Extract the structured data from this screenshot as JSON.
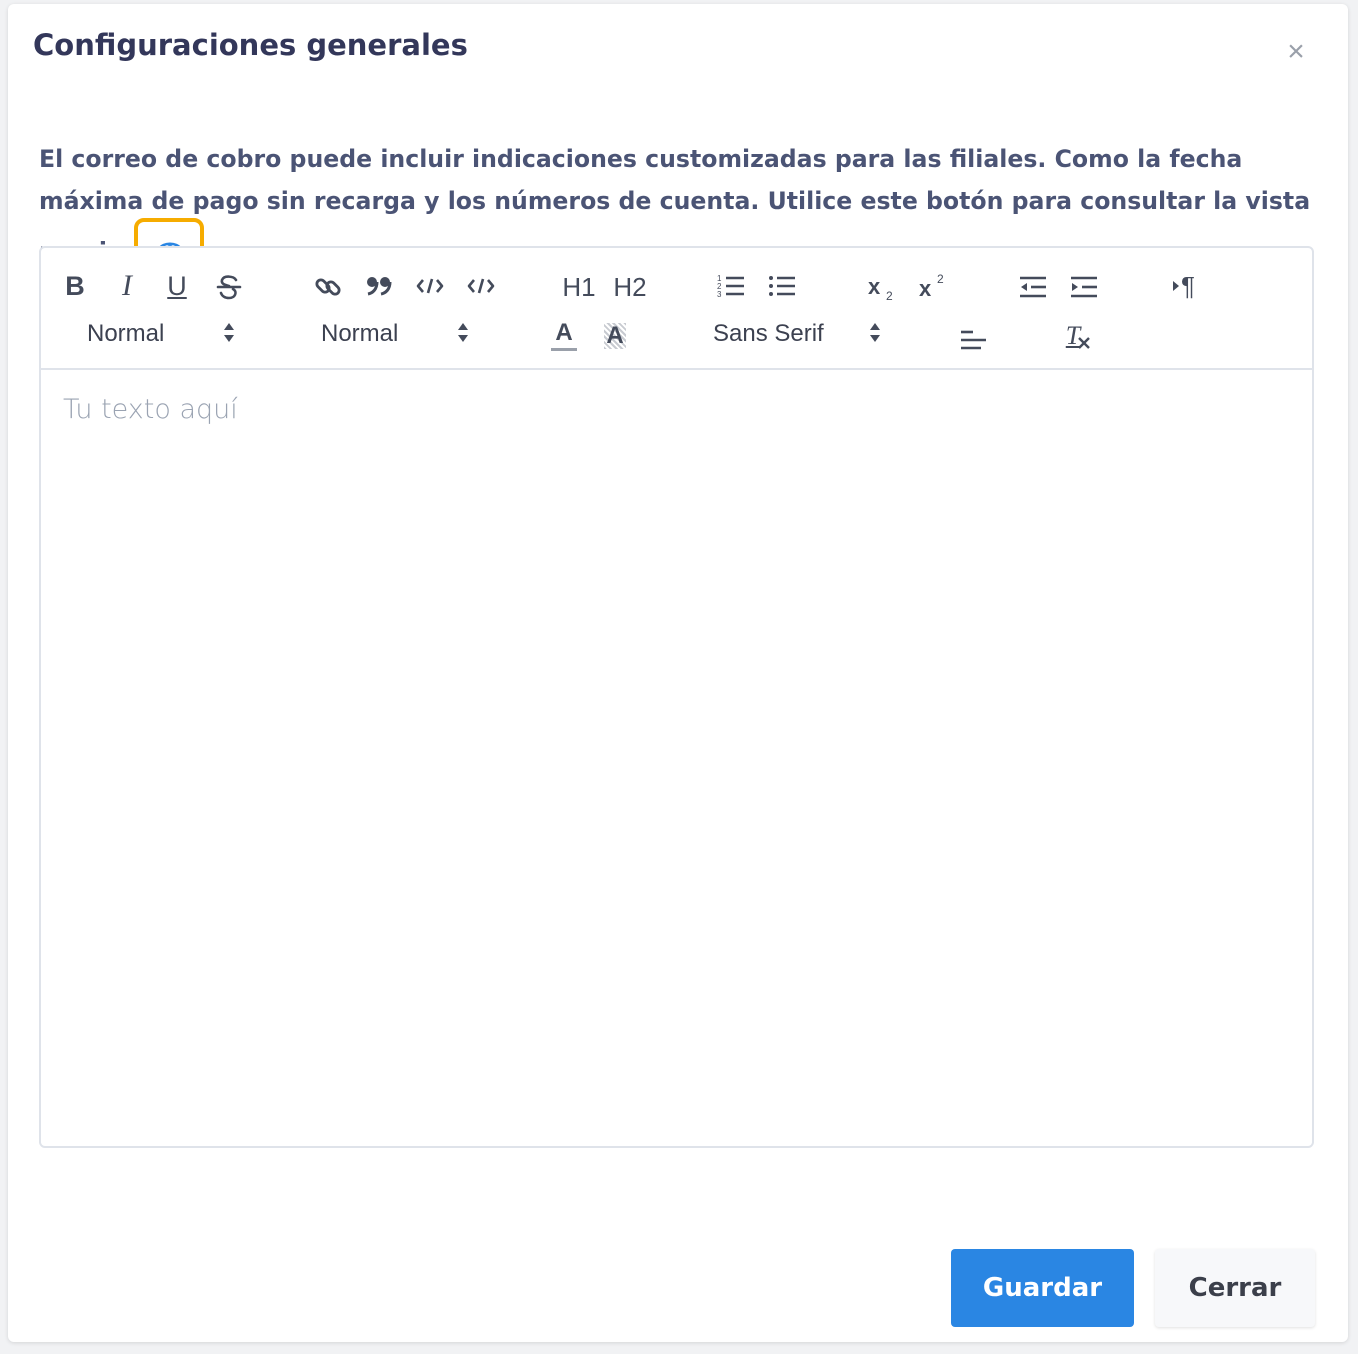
{
  "modal": {
    "title": "Configuraciones generales",
    "close_symbol": "×",
    "description": "El correo de cobro puede incluir indicaciones customizadas para las filiales. Como la fecha máxima de pago sin recarga y los números de cuenta. Utilice este botón para consultar la vista previa:",
    "preview_icon": "eye-icon",
    "highlight_color": "#f6ac00"
  },
  "toolbar": {
    "bold": "B",
    "italic": "I",
    "underline": "U",
    "header1": "H1",
    "header2": "H2",
    "size_picker": "Normal",
    "header_picker": "Normal",
    "font_picker": "Sans Serif",
    "text_color_letter": "A",
    "background_letter": "A",
    "clear_format_letter": "T",
    "direction_symbol": "¶"
  },
  "editor": {
    "placeholder": "Tu texto aquí"
  },
  "footer": {
    "save_label": "Guardar",
    "close_label": "Cerrar"
  },
  "colors": {
    "primary": "#2a86e3",
    "title": "#33375a",
    "text": "#4b5475"
  }
}
